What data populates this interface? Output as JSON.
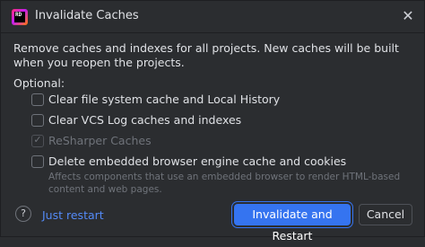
{
  "dialog": {
    "title": "Invalidate Caches",
    "app_icon_text": "RD",
    "description": "Remove caches and indexes for all projects. New caches will be built when you reopen the projects.",
    "optional_label": "Optional:",
    "options": [
      {
        "label": "Clear file system cache and Local History",
        "checked": false,
        "enabled": true
      },
      {
        "label": "Clear VCS Log caches and indexes",
        "checked": false,
        "enabled": true
      },
      {
        "label": "ReSharper Caches",
        "checked": true,
        "enabled": false
      },
      {
        "label": "Delete embedded browser engine cache and cookies",
        "checked": false,
        "enabled": true
      }
    ],
    "browser_note": "Affects components that use an embedded browser to render HTML-based content and web pages.",
    "help_label": "?",
    "just_restart_label": "Just restart",
    "primary_button_label": "Invalidate and Restart",
    "cancel_button_label": "Cancel"
  },
  "colors": {
    "background": "#2b2d30",
    "primary": "#3574f0",
    "link": "#548af7",
    "text": "#dfe1e5",
    "muted": "#6f737a"
  }
}
